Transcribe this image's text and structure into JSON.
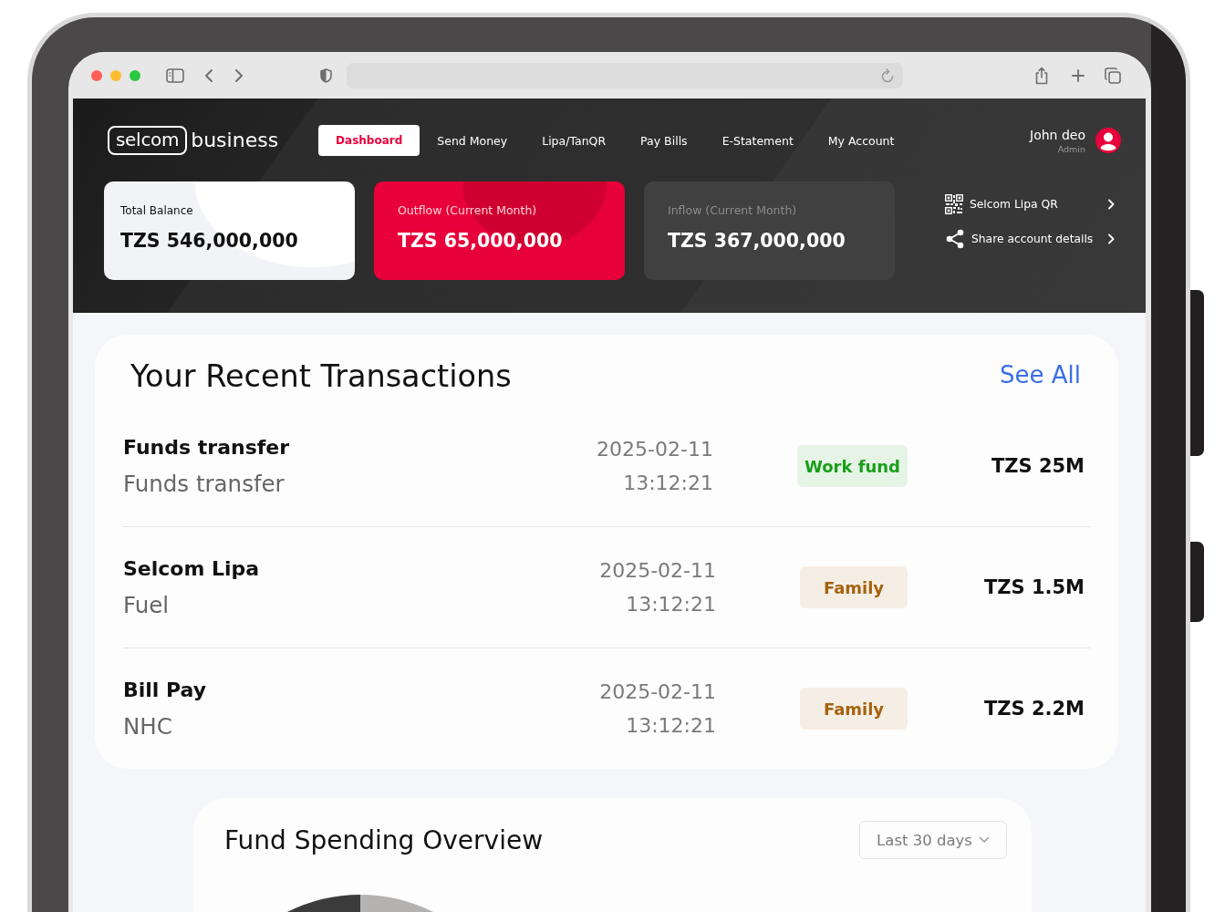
{
  "header": {
    "logo": {
      "mark": "selcom",
      "wordmark": "business"
    },
    "nav": [
      {
        "label": "Dashboard",
        "selected": true
      },
      {
        "label": "Send Money",
        "selected": false
      },
      {
        "label": "Lipa/TanQR",
        "selected": false
      },
      {
        "label": "Pay Bills",
        "selected": false
      },
      {
        "label": "E-Statement",
        "selected": false
      },
      {
        "label": "My Account",
        "selected": false
      }
    ],
    "user": {
      "name": "John deo",
      "role": "Admin"
    }
  },
  "summary_cards": [
    {
      "kind": "balance",
      "label": "Total Balance",
      "value": "TZS 546,000,000"
    },
    {
      "kind": "outflow",
      "label": "Outflow (Current Month)",
      "value": "TZS 65,000,000"
    },
    {
      "kind": "inflow",
      "label": "Inflow (Current Month)",
      "value": "TZS 367,000,000"
    }
  ],
  "quick_links": [
    {
      "kind": "qr",
      "label": "Selcom Lipa QR"
    },
    {
      "kind": "share",
      "label": "Share account details"
    }
  ],
  "recent_transactions": {
    "title": "Your Recent Transactions",
    "see_all": "See All",
    "rows": [
      {
        "title": "Funds transfer",
        "subtitle": "Funds transfer",
        "date": "2025-02-11",
        "time": "13:12:21",
        "tag": {
          "label": "Work fund",
          "color": "#1a9e1a"
        },
        "amount": "TZS 25M"
      },
      {
        "title": "Selcom Lipa",
        "subtitle": "Fuel",
        "date": "2025-02-11",
        "time": "13:12:21",
        "tag": {
          "label": "Family",
          "color": "#a5620f"
        },
        "amount": "TZS 1.5M"
      },
      {
        "title": "Bill Pay",
        "subtitle": "NHC",
        "date": "2025-02-11",
        "time": "13:12:21",
        "tag": {
          "label": "Family",
          "color": "#a5620f"
        },
        "amount": "TZS 2.2M"
      }
    ]
  },
  "fund_spending_overview": {
    "title": "Fund Spending Overview",
    "period": "Last 30 days"
  }
}
